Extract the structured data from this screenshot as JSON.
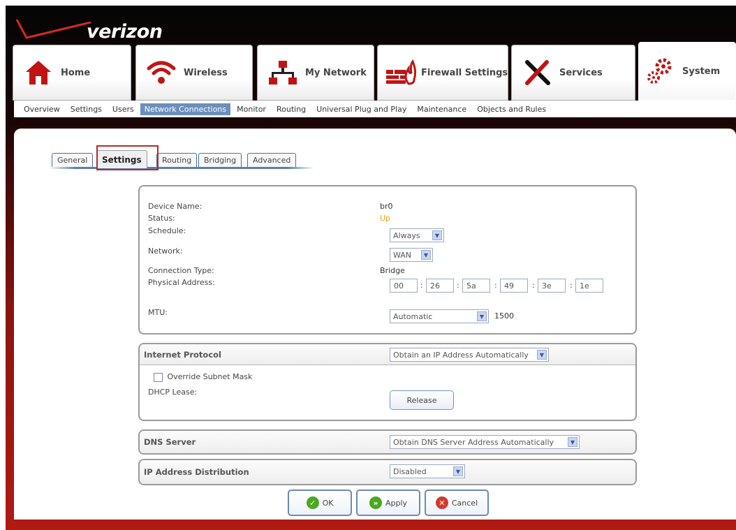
{
  "brand": {
    "logo_text": "verizon"
  },
  "main_tabs": [
    {
      "label": "Home",
      "icon": "home-icon"
    },
    {
      "label": "Wireless",
      "icon": "wifi-icon"
    },
    {
      "label": "My Network",
      "icon": "network-icon"
    },
    {
      "label": "Firewall Settings",
      "icon": "firewall-icon"
    },
    {
      "label": "Services",
      "icon": "tools-icon"
    },
    {
      "label": "System",
      "icon": "gears-icon",
      "active": true
    }
  ],
  "subnav": [
    "Overview",
    "Settings",
    "Users",
    "Network Connections",
    "Monitor",
    "Routing",
    "Universal Plug and Play",
    "Maintenance",
    "Objects and Rules"
  ],
  "subnav_active": "Network Connections",
  "subtabs": [
    "General",
    "Settings",
    "Routing",
    "Bridging",
    "Advanced"
  ],
  "subtab_active": "Settings",
  "general": {
    "device_name_label": "Device Name:",
    "device_name": "br0",
    "status_label": "Status:",
    "status": "Up",
    "schedule_label": "Schedule:",
    "schedule": "Always",
    "network_label": "Network:",
    "network": "WAN",
    "connection_type_label": "Connection Type:",
    "connection_type": "Bridge",
    "physical_address_label": "Physical Address:",
    "mac": [
      "00",
      "26",
      "5a",
      "49",
      "3e",
      "1e"
    ],
    "mtu_label": "MTU:",
    "mtu_mode": "Automatic",
    "mtu_value": "1500"
  },
  "internet_protocol": {
    "title": "Internet Protocol",
    "mode": "Obtain an IP Address Automatically",
    "override_label": "Override Subnet Mask",
    "dhcp_lease_label": "DHCP Lease:",
    "release_label": "Release"
  },
  "dns_server": {
    "title": "DNS Server",
    "mode": "Obtain DNS Server Address Automatically"
  },
  "ip_distribution": {
    "title": "IP Address Distribution",
    "mode": "Disabled"
  },
  "buttons": {
    "ok": "OK",
    "apply": "Apply",
    "cancel": "Cancel"
  },
  "colors": {
    "status_up": "#e6a000",
    "subnav_active": "#6b8fbd",
    "highlight": "#b72a2a"
  }
}
